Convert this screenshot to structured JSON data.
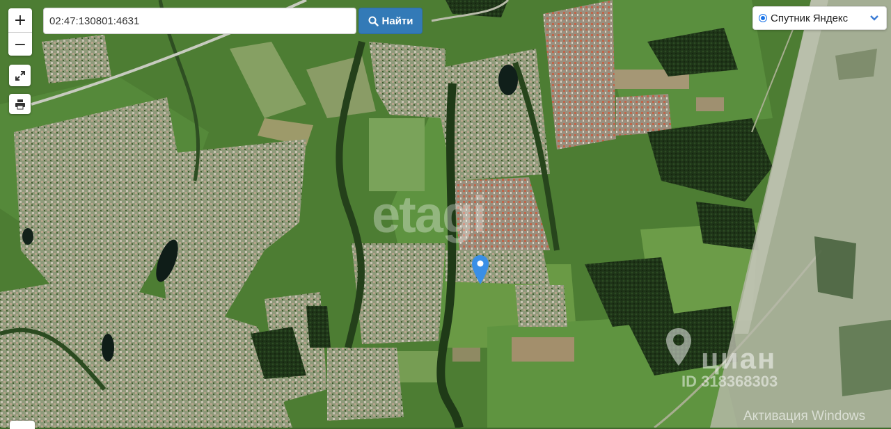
{
  "map": {
    "type": "satellite",
    "layer_label": "Спутник Яндекс",
    "marker": {
      "icon": "map-pin-icon",
      "color": "#3a8fe6"
    }
  },
  "controls": {
    "zoom_in_label": "+",
    "zoom_out_label": "−",
    "fullscreen_icon": "expand-icon",
    "print_icon": "printer-icon"
  },
  "search": {
    "value": "02:47:130801:4631",
    "button_label": "Найти",
    "button_icon": "search-icon",
    "button_color": "#337ab7"
  },
  "watermarks": {
    "etagi": "etagi",
    "cian_name": "циан",
    "cian_id": "ID 318368303",
    "windows": "Активация Windows"
  }
}
